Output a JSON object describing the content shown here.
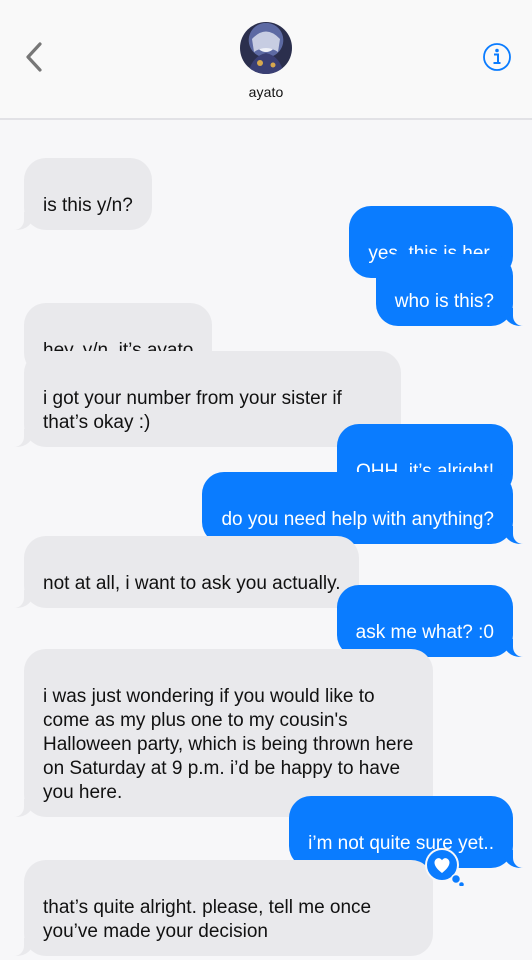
{
  "header": {
    "contact_name": "ayato",
    "back_icon": "chevron-left-icon",
    "info_icon": "info-circle-icon",
    "accent_color": "#0a7cff"
  },
  "messages": [
    {
      "sender": "them",
      "text": "is this y/n?"
    },
    {
      "sender": "me",
      "text": "yes, this is her."
    },
    {
      "sender": "me",
      "text": "who is this?"
    },
    {
      "sender": "them",
      "text": "hey, y/n. it’s ayato"
    },
    {
      "sender": "them",
      "text": "i got your number from your sister if that’s okay :)"
    },
    {
      "sender": "me",
      "text": "OHH, it’s alright!"
    },
    {
      "sender": "me",
      "text": "do you need help with anything?"
    },
    {
      "sender": "them",
      "text": "not at all, i want to ask you actually."
    },
    {
      "sender": "me",
      "text": "ask me what? :0"
    },
    {
      "sender": "them",
      "text": "i was just wondering if you would like to come as my plus one to my cousin's Halloween party, which is being thrown here on Saturday at 9 p.m. i’d be happy to have you here."
    },
    {
      "sender": "me",
      "text": "i’m not quite sure yet.."
    },
    {
      "sender": "them",
      "text": "that’s quite alright. please, tell me once you’ve made your decision",
      "reaction": "heart-tapback-icon"
    }
  ]
}
